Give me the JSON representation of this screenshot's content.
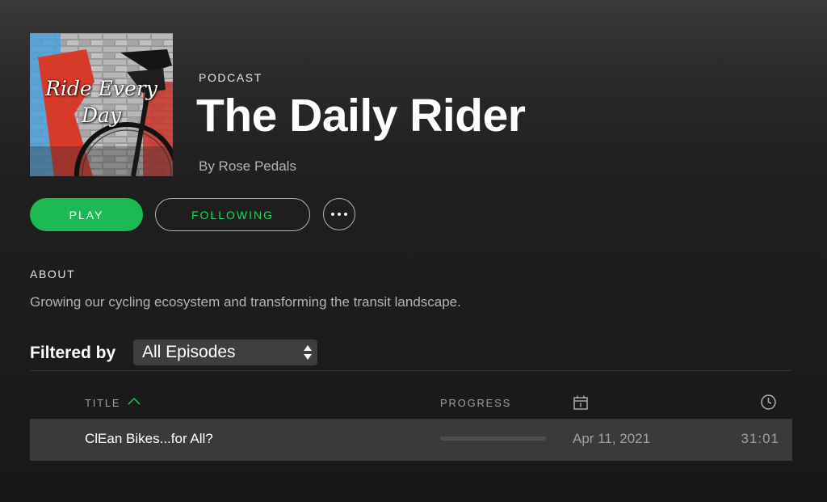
{
  "podcast": {
    "kind_label": "PODCAST",
    "title": "The Daily Rider",
    "byline": "By Rose Pedals",
    "cover_art_text": "Ride Every Day"
  },
  "actions": {
    "play_label": "PLAY",
    "follow_label": "FOLLOWING",
    "more_icon": "more-options-icon"
  },
  "about": {
    "label": "ABOUT",
    "text": "Growing our cycling ecosystem and transforming the transit landscape."
  },
  "filter": {
    "label": "Filtered by",
    "selected": "All Episodes"
  },
  "table": {
    "headers": {
      "title": "TITLE",
      "progress": "PROGRESS",
      "date_icon": "calendar-icon",
      "duration_icon": "clock-icon"
    },
    "sort": {
      "column": "title",
      "icon": "sort-up-icon"
    },
    "rows": [
      {
        "title": "ClEan Bikes...for All?",
        "progress": 0,
        "date": "Apr 11, 2021",
        "duration": "31:01"
      }
    ]
  },
  "colors": {
    "accent_green": "#1db954",
    "following_text": "#1ed760",
    "background": "#181818",
    "row_highlight": "#3a3a3a",
    "muted_text": "#b3b3b3"
  }
}
